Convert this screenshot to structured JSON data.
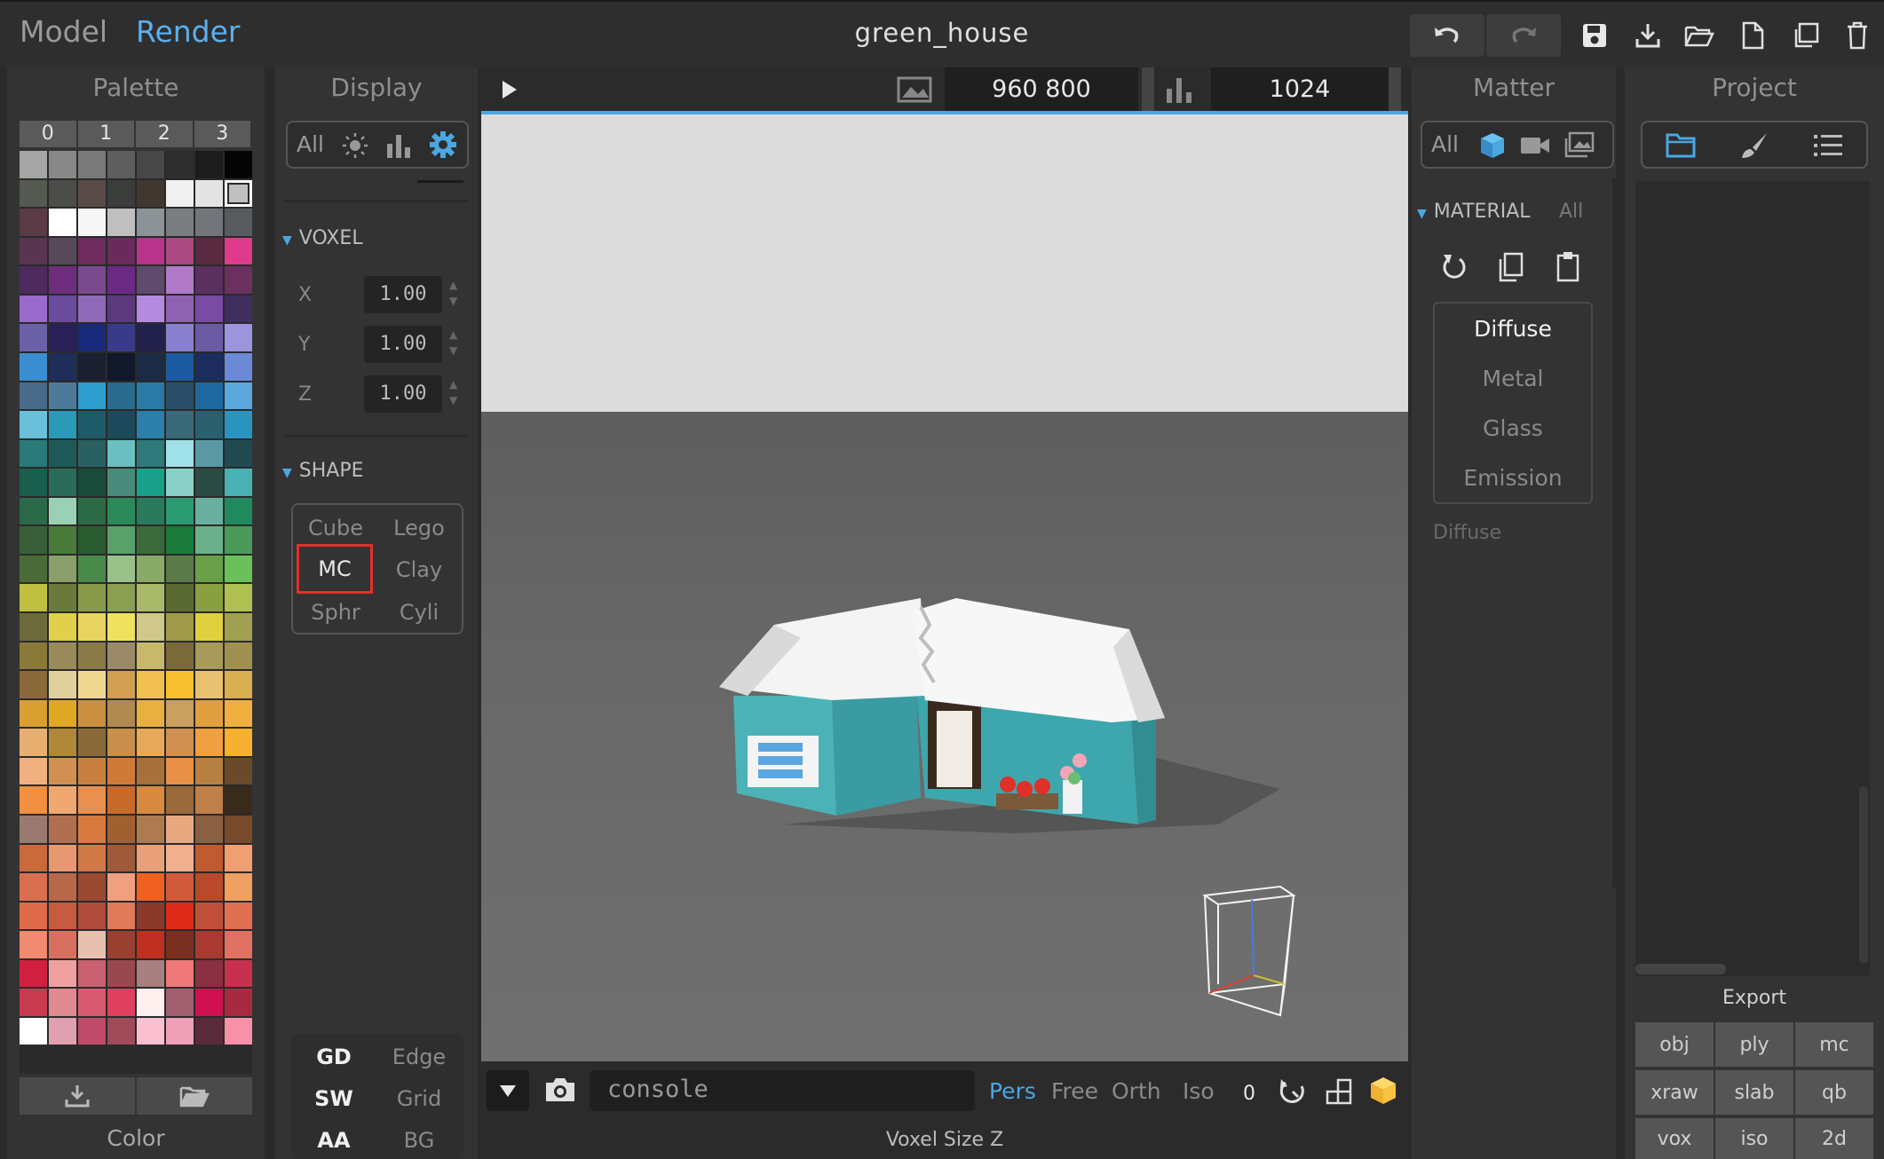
{
  "topbar": {
    "mode_model": "Model",
    "mode_render": "Render",
    "title": "green_house"
  },
  "palette": {
    "title": "Palette",
    "columns": [
      "0",
      "1",
      "2",
      "3"
    ],
    "footer": "Color",
    "colors": [
      "#a6a6a6",
      "#888888",
      "#7a7a7a",
      "#5e5e5e",
      "#474747",
      "#2e2e2e",
      "#1c1c1c",
      "#050505",
      "#545a52",
      "#4a4d48",
      "#5a4a48",
      "#3b3d3a",
      "#403830",
      "#f0f0f0",
      "#e4e4e4",
      "#c0c0c0",
      "#5a3a44",
      "#ffffff",
      "#f7f7f7",
      "#bfbfbf",
      "#8b9396",
      "#7a7e80",
      "#72767a",
      "#575b5e",
      "#5a3550",
      "#57485a",
      "#6e2c5c",
      "#6a2a5a",
      "#b8348a",
      "#aa4a82",
      "#5b2a40",
      "#e03a8c",
      "#4e2a5e",
      "#6e2e7c",
      "#7a4a8e",
      "#6a2a84",
      "#5e4a6a",
      "#b07ac8",
      "#5a3060",
      "#6a3060",
      "#9a6acc",
      "#6a4c9c",
      "#8e6ab8",
      "#5a3a7c",
      "#b48ae0",
      "#8e62b0",
      "#7a4aa4",
      "#3e2f5e",
      "#6a60a8",
      "#2a2058",
      "#1a2a7a",
      "#3a3a8a",
      "#22214e",
      "#8a80d0",
      "#6a5aa4",
      "#9c94dc",
      "#3b8ed0",
      "#1e2d5a",
      "#1a2030",
      "#10182a",
      "#1c2a44",
      "#1a5aa0",
      "#1a2d5e",
      "#6a8ad8",
      "#4a6a8a",
      "#4c7a98",
      "#2e9ccc",
      "#2a6a8c",
      "#2a7aa8",
      "#2a4e6a",
      "#1e68a0",
      "#5aa8de",
      "#6ac0d8",
      "#2a9ab8",
      "#1e5a68",
      "#1c4a5a",
      "#2a80a8",
      "#3a6a78",
      "#2a6070",
      "#2a94c0",
      "#2a7a7a",
      "#1e5a5a",
      "#2a6060",
      "#6ac0c0",
      "#2e7a7a",
      "#a0e0e8",
      "#5a9aa4",
      "#1e4a50",
      "#1a5e4e",
      "#2a6a5a",
      "#1a4a3a",
      "#4a8a7a",
      "#18a08a",
      "#8ad0c8",
      "#2a4a44",
      "#4ab0b4",
      "#2a6a4a",
      "#9ad0b4",
      "#2a6a44",
      "#2a8a5a",
      "#2a7a5e",
      "#2a9a70",
      "#6ab0a0",
      "#1e8a5e",
      "#3a5e3a",
      "#4a7a3a",
      "#2a5a30",
      "#5aa06a",
      "#3a6a3a",
      "#1a7a3a",
      "#6ab08a",
      "#4a9a5a",
      "#4a6a3a",
      "#8aa06a",
      "#4a8a4a",
      "#9ac08a",
      "#8aaa6a",
      "#5a7a4a",
      "#6aa04a",
      "#6ac05a",
      "#c0c040",
      "#6a7a3a",
      "#8a9a4a",
      "#8aa050",
      "#aab86a",
      "#5a6a30",
      "#8aa040",
      "#b0c050",
      "#6a6a3a",
      "#e0d04a",
      "#e8d460",
      "#f0e060",
      "#d0c88a",
      "#a09a4a",
      "#e0d040",
      "#a0a050",
      "#8a7a3a",
      "#9a8a5a",
      "#8a7a4a",
      "#9a8a6a",
      "#c8b86a",
      "#7a6a3a",
      "#a89a5a",
      "#a09050",
      "#8a6a3a",
      "#e0d09a",
      "#f0d890",
      "#d0a050",
      "#f0c050",
      "#f8c030",
      "#e8c070",
      "#d8b050",
      "#d8a030",
      "#e0a820",
      "#c89040",
      "#b08a50",
      "#e8b040",
      "#c8a060",
      "#e0a040",
      "#f0b040",
      "#e8b070",
      "#b0883a",
      "#8a6a3a",
      "#c8904a",
      "#e8a85a",
      "#d09050",
      "#f0a040",
      "#f8b030",
      "#f0b080",
      "#d09050",
      "#c88040",
      "#d07a3a",
      "#a8703a",
      "#e89048",
      "#b88040",
      "#6a4a2a",
      "#f09040",
      "#f0a870",
      "#e89050",
      "#c86a2a",
      "#d88a40",
      "#9a6a3a",
      "#c08048",
      "#3a2a1a",
      "#9a7a70",
      "#b07050",
      "#d87a40",
      "#a06030",
      "#b07a50",
      "#e8a880",
      "#8a6040",
      "#7a4a2a",
      "#c86a3a",
      "#e89870",
      "#d07848",
      "#a05a3a",
      "#e8a078",
      "#f0b090",
      "#c05a30",
      "#f0a070",
      "#d87050",
      "#b8684a",
      "#9a4a30",
      "#f0a080",
      "#f06020",
      "#d05a3a",
      "#b84a2a",
      "#f0a060",
      "#e06a4a",
      "#c85a40",
      "#b04a3a",
      "#e07a5a",
      "#8a3a2a",
      "#e02a1a",
      "#c0503a",
      "#e07050",
      "#f08a70",
      "#d87060",
      "#e8c0b0",
      "#9a4030",
      "#c03020",
      "#7a3020",
      "#a83a30",
      "#e07060",
      "#d02040",
      "#f0a0a0",
      "#c86070",
      "#9a4850",
      "#a88080",
      "#f07878",
      "#8a3040",
      "#c83050",
      "#c83a50",
      "#e08a90",
      "#d85a70",
      "#e04060",
      "#fff0f0",
      "#a06070",
      "#d01050",
      "#a82a40",
      "#ffffff",
      "#e0a0b0",
      "#c04a6a",
      "#a04a5a",
      "#f8c0d0",
      "#f0a0b8",
      "#5a2a3a",
      "#f890a8"
    ]
  },
  "display": {
    "title": "Display",
    "tab_all": "All",
    "voxel_section": "VOXEL",
    "x_label": "X",
    "x_value": "1.00",
    "y_label": "Y",
    "y_value": "1.00",
    "z_label": "Z",
    "z_value": "1.00",
    "shape_section": "SHAPE",
    "shapes": {
      "cube": "Cube",
      "lego": "Lego",
      "mc": "MC",
      "clay": "Clay",
      "sphr": "Sphr",
      "cyli": "Cyli"
    },
    "bottom": {
      "gd": "GD",
      "edge": "Edge",
      "sw": "SW",
      "grid": "Grid",
      "aa": "AA",
      "bg": "BG"
    }
  },
  "viewport": {
    "resolution": "960  800",
    "samples": "1024",
    "console_placeholder": "console",
    "camera_modes": [
      "Pers",
      "Free",
      "Orth",
      "Iso"
    ],
    "counter": "0",
    "status": "Voxel Size Z",
    "accent": "#4aa7e0"
  },
  "matter": {
    "title": "Matter",
    "tab_all": "All",
    "section": "MATERIAL",
    "section_all": "All",
    "materials": [
      "Diffuse",
      "Metal",
      "Glass",
      "Emission"
    ],
    "current": "Diffuse"
  },
  "project": {
    "title": "Project",
    "export_label": "Export",
    "export_buttons": [
      "obj",
      "ply",
      "mc",
      "xraw",
      "slab",
      "qb",
      "vox",
      "iso",
      "2d"
    ]
  }
}
